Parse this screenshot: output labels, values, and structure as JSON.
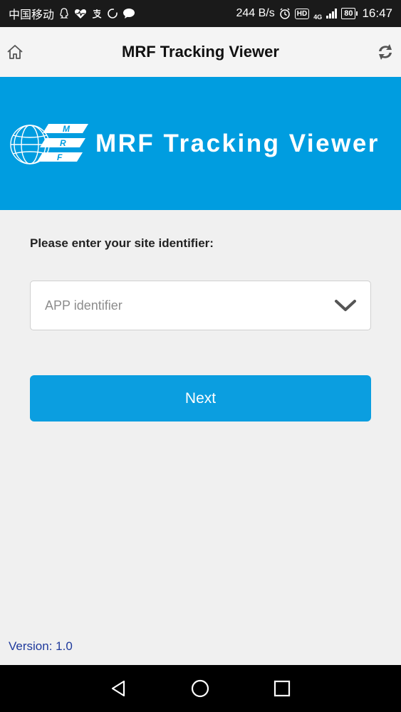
{
  "status_bar": {
    "carrier": "中国移动",
    "speed": "244 B/s",
    "network": "4G",
    "battery": "80",
    "time": "16:47",
    "hd": "HD",
    "icons": [
      "qq-icon",
      "health-icon",
      "alipay-icon",
      "circle-icon",
      "chat-icon",
      "alarm-icon",
      "hd-icon",
      "signal-icon",
      "battery-icon"
    ]
  },
  "header": {
    "title": "MRF Tracking Viewer"
  },
  "banner": {
    "title": "MRF Tracking Viewer",
    "logo_text": "MRF"
  },
  "form": {
    "prompt": "Please enter your site identifier:",
    "select_placeholder": "APP identifier",
    "next_label": "Next"
  },
  "footer": {
    "version": "Version: 1.0"
  },
  "colors": {
    "banner": "#009de0",
    "button": "#0b9ee0",
    "version_text": "#1f3a9c"
  }
}
